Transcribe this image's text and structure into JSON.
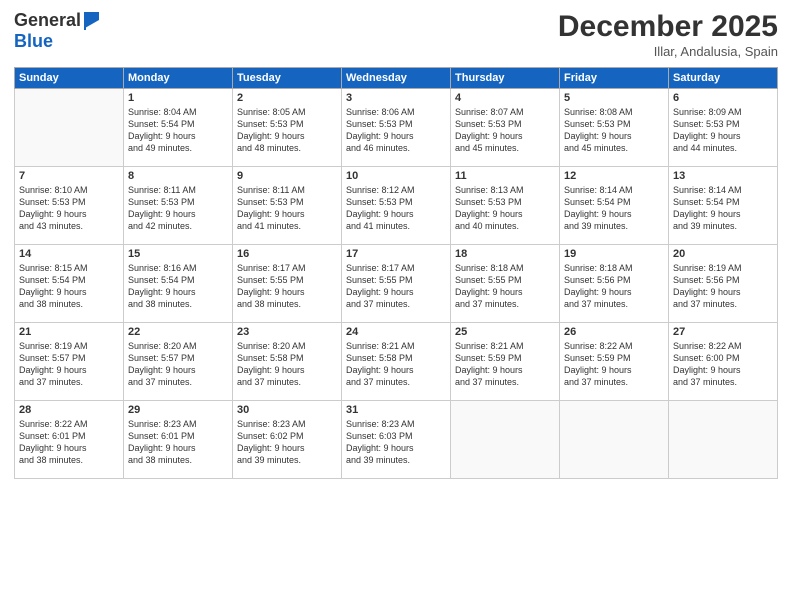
{
  "header": {
    "logo_general": "General",
    "logo_blue": "Blue",
    "month_title": "December 2025",
    "location": "Illar, Andalusia, Spain"
  },
  "weekdays": [
    "Sunday",
    "Monday",
    "Tuesday",
    "Wednesday",
    "Thursday",
    "Friday",
    "Saturday"
  ],
  "weeks": [
    [
      {
        "day": "",
        "info": ""
      },
      {
        "day": "1",
        "info": "Sunrise: 8:04 AM\nSunset: 5:54 PM\nDaylight: 9 hours\nand 49 minutes."
      },
      {
        "day": "2",
        "info": "Sunrise: 8:05 AM\nSunset: 5:53 PM\nDaylight: 9 hours\nand 48 minutes."
      },
      {
        "day": "3",
        "info": "Sunrise: 8:06 AM\nSunset: 5:53 PM\nDaylight: 9 hours\nand 46 minutes."
      },
      {
        "day": "4",
        "info": "Sunrise: 8:07 AM\nSunset: 5:53 PM\nDaylight: 9 hours\nand 45 minutes."
      },
      {
        "day": "5",
        "info": "Sunrise: 8:08 AM\nSunset: 5:53 PM\nDaylight: 9 hours\nand 45 minutes."
      },
      {
        "day": "6",
        "info": "Sunrise: 8:09 AM\nSunset: 5:53 PM\nDaylight: 9 hours\nand 44 minutes."
      }
    ],
    [
      {
        "day": "7",
        "info": "Sunrise: 8:10 AM\nSunset: 5:53 PM\nDaylight: 9 hours\nand 43 minutes."
      },
      {
        "day": "8",
        "info": "Sunrise: 8:11 AM\nSunset: 5:53 PM\nDaylight: 9 hours\nand 42 minutes."
      },
      {
        "day": "9",
        "info": "Sunrise: 8:11 AM\nSunset: 5:53 PM\nDaylight: 9 hours\nand 41 minutes."
      },
      {
        "day": "10",
        "info": "Sunrise: 8:12 AM\nSunset: 5:53 PM\nDaylight: 9 hours\nand 41 minutes."
      },
      {
        "day": "11",
        "info": "Sunrise: 8:13 AM\nSunset: 5:53 PM\nDaylight: 9 hours\nand 40 minutes."
      },
      {
        "day": "12",
        "info": "Sunrise: 8:14 AM\nSunset: 5:54 PM\nDaylight: 9 hours\nand 39 minutes."
      },
      {
        "day": "13",
        "info": "Sunrise: 8:14 AM\nSunset: 5:54 PM\nDaylight: 9 hours\nand 39 minutes."
      }
    ],
    [
      {
        "day": "14",
        "info": "Sunrise: 8:15 AM\nSunset: 5:54 PM\nDaylight: 9 hours\nand 38 minutes."
      },
      {
        "day": "15",
        "info": "Sunrise: 8:16 AM\nSunset: 5:54 PM\nDaylight: 9 hours\nand 38 minutes."
      },
      {
        "day": "16",
        "info": "Sunrise: 8:17 AM\nSunset: 5:55 PM\nDaylight: 9 hours\nand 38 minutes."
      },
      {
        "day": "17",
        "info": "Sunrise: 8:17 AM\nSunset: 5:55 PM\nDaylight: 9 hours\nand 37 minutes."
      },
      {
        "day": "18",
        "info": "Sunrise: 8:18 AM\nSunset: 5:55 PM\nDaylight: 9 hours\nand 37 minutes."
      },
      {
        "day": "19",
        "info": "Sunrise: 8:18 AM\nSunset: 5:56 PM\nDaylight: 9 hours\nand 37 minutes."
      },
      {
        "day": "20",
        "info": "Sunrise: 8:19 AM\nSunset: 5:56 PM\nDaylight: 9 hours\nand 37 minutes."
      }
    ],
    [
      {
        "day": "21",
        "info": "Sunrise: 8:19 AM\nSunset: 5:57 PM\nDaylight: 9 hours\nand 37 minutes."
      },
      {
        "day": "22",
        "info": "Sunrise: 8:20 AM\nSunset: 5:57 PM\nDaylight: 9 hours\nand 37 minutes."
      },
      {
        "day": "23",
        "info": "Sunrise: 8:20 AM\nSunset: 5:58 PM\nDaylight: 9 hours\nand 37 minutes."
      },
      {
        "day": "24",
        "info": "Sunrise: 8:21 AM\nSunset: 5:58 PM\nDaylight: 9 hours\nand 37 minutes."
      },
      {
        "day": "25",
        "info": "Sunrise: 8:21 AM\nSunset: 5:59 PM\nDaylight: 9 hours\nand 37 minutes."
      },
      {
        "day": "26",
        "info": "Sunrise: 8:22 AM\nSunset: 5:59 PM\nDaylight: 9 hours\nand 37 minutes."
      },
      {
        "day": "27",
        "info": "Sunrise: 8:22 AM\nSunset: 6:00 PM\nDaylight: 9 hours\nand 37 minutes."
      }
    ],
    [
      {
        "day": "28",
        "info": "Sunrise: 8:22 AM\nSunset: 6:01 PM\nDaylight: 9 hours\nand 38 minutes."
      },
      {
        "day": "29",
        "info": "Sunrise: 8:23 AM\nSunset: 6:01 PM\nDaylight: 9 hours\nand 38 minutes."
      },
      {
        "day": "30",
        "info": "Sunrise: 8:23 AM\nSunset: 6:02 PM\nDaylight: 9 hours\nand 39 minutes."
      },
      {
        "day": "31",
        "info": "Sunrise: 8:23 AM\nSunset: 6:03 PM\nDaylight: 9 hours\nand 39 minutes."
      },
      {
        "day": "",
        "info": ""
      },
      {
        "day": "",
        "info": ""
      },
      {
        "day": "",
        "info": ""
      }
    ]
  ]
}
